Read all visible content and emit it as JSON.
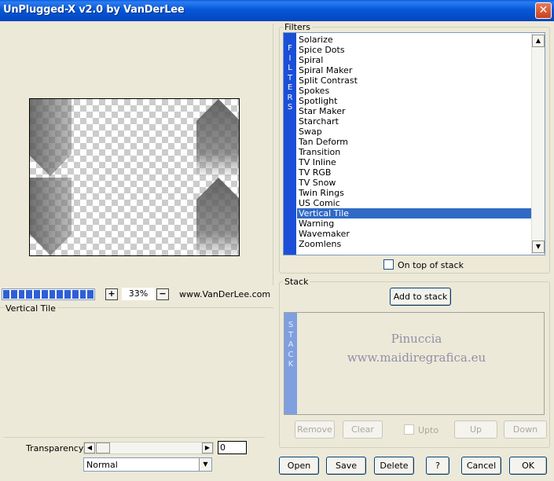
{
  "window": {
    "title": "UnPlugged-X v2.0 by VanDerLee",
    "close_label": "✕"
  },
  "filters": {
    "group_label": "Filters",
    "side_tab_letters": [
      "F",
      "I",
      "L",
      "T",
      "E",
      "R",
      "S"
    ],
    "items": [
      {
        "label": "Solarize"
      },
      {
        "label": "Spice Dots"
      },
      {
        "label": "Spiral"
      },
      {
        "label": "Spiral Maker"
      },
      {
        "label": "Split Contrast"
      },
      {
        "label": "Spokes"
      },
      {
        "label": "Spotlight"
      },
      {
        "label": "Star Maker"
      },
      {
        "label": "Starchart"
      },
      {
        "label": "Swap"
      },
      {
        "label": "Tan Deform"
      },
      {
        "label": "Transition"
      },
      {
        "label": "TV Inline"
      },
      {
        "label": "TV RGB"
      },
      {
        "label": "TV Snow"
      },
      {
        "label": "Twin Rings"
      },
      {
        "label": "US Comic"
      },
      {
        "label": "Vertical Tile"
      },
      {
        "label": "Warning"
      },
      {
        "label": "Wavemaker"
      },
      {
        "label": "Zoomlens"
      }
    ],
    "selected": "Vertical Tile",
    "on_top_label": "On top of stack"
  },
  "preview": {
    "progress_segments": 12,
    "zoom_minus": "−",
    "zoom_plus": "+",
    "zoom_value": "33%",
    "site": "www.VanDerLee.com"
  },
  "description": {
    "label": "Vertical Tile"
  },
  "transparency": {
    "label": "Transparency",
    "value": "0"
  },
  "blend_mode": {
    "value": "Normal"
  },
  "stack": {
    "group_label": "Stack",
    "add_label": "Add to stack",
    "side_tab_letters": [
      "S",
      "T",
      "A",
      "C",
      "K"
    ],
    "remove_label": "Remove",
    "clear_label": "Clear",
    "upto_label": "Upto",
    "up_label": "Up",
    "down_label": "Down"
  },
  "watermark": {
    "line1": "Pinuccia",
    "line2": "www.maidiregrafica.eu"
  },
  "footer": {
    "open_label": "Open",
    "save_label": "Save",
    "delete_label": "Delete",
    "help_label": "?",
    "cancel_label": "Cancel",
    "ok_label": "OK"
  }
}
